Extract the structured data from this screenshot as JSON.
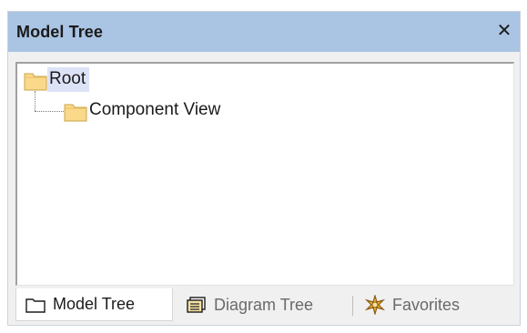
{
  "panel": {
    "title": "Model Tree",
    "close_label": "✕"
  },
  "tree": {
    "nodes": [
      {
        "label": "Root",
        "icon": "folder-icon",
        "selected": true
      },
      {
        "label": "Component View",
        "icon": "folder-icon",
        "selected": false
      }
    ]
  },
  "tabs": [
    {
      "label": "Model Tree",
      "icon": "model-tree-icon",
      "active": true
    },
    {
      "label": "Diagram Tree",
      "icon": "diagram-tree-icon",
      "active": false
    },
    {
      "label": "Favorites",
      "icon": "favorites-icon",
      "active": false
    }
  ],
  "colors": {
    "titlebar": "#aac4e3",
    "selection": "#dde3f7",
    "folder_fill": "#fbd98a",
    "folder_stroke": "#c8a44a"
  }
}
